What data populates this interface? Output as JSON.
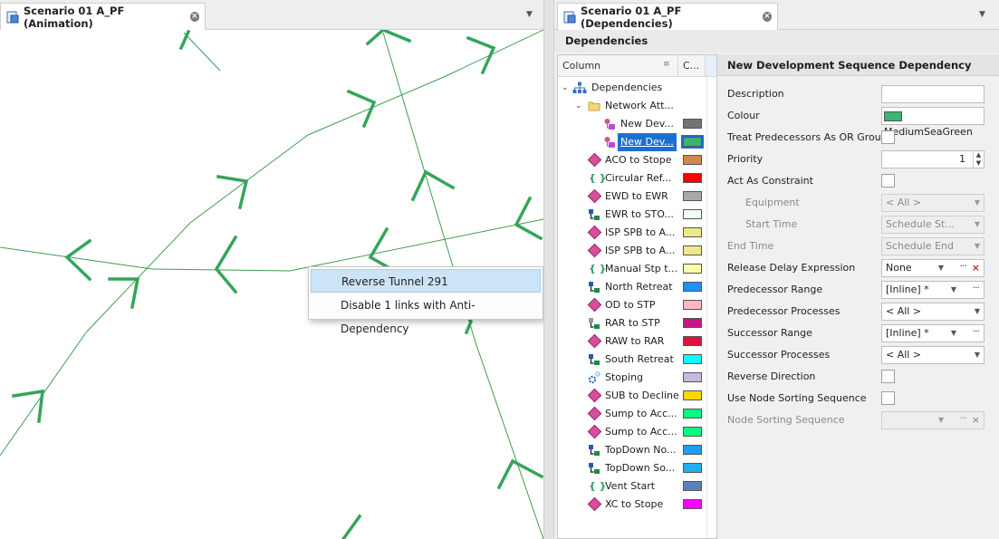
{
  "left_tab": {
    "title": "Scenario 01 A_PF (Animation)"
  },
  "right_tab": {
    "title": "Scenario 01 A_PF (Dependencies)"
  },
  "context_menu": {
    "items": [
      "Reverse Tunnel 291",
      "Disable 1 links with Anti-Dependency"
    ],
    "highlighted_index": 0
  },
  "dependencies_panel": {
    "header": "Dependencies",
    "columns": [
      "Column",
      "C..."
    ],
    "tree": [
      {
        "label": "Dependencies",
        "level": 0,
        "icon": "hierarchy-icon",
        "expanded": true
      },
      {
        "label": "Network Att...",
        "level": 1,
        "icon": "folder-icon",
        "expanded": true
      },
      {
        "label": "New Dev...",
        "level": 2,
        "icon": "dependency-node-icon",
        "color": "#737373"
      },
      {
        "label": "New Dev...",
        "level": 2,
        "icon": "dependency-node-icon",
        "color": "#3cb371",
        "selected": true
      },
      {
        "label": "ACO to Stope",
        "level": 1,
        "icon": "diamond-icon",
        "color": "#d2874b"
      },
      {
        "label": "Circular Ref...",
        "level": 1,
        "icon": "braces-icon",
        "color": "#ff0000"
      },
      {
        "label": "EWD to EWR",
        "level": 1,
        "icon": "diamond-icon",
        "color": "#a9a9a9"
      },
      {
        "label": "EWR to STO...",
        "level": 1,
        "icon": "link-node-icon",
        "color": "#f0fff0"
      },
      {
        "label": "ISP SPB to A...",
        "level": 1,
        "icon": "diamond-icon",
        "color": "#f0e68c"
      },
      {
        "label": "ISP SPB to A...",
        "level": 1,
        "icon": "diamond-icon",
        "color": "#f0e68c"
      },
      {
        "label": "Manual Stp t...",
        "level": 1,
        "icon": "braces-icon",
        "color": "#fffaaa"
      },
      {
        "label": "North Retreat",
        "level": 1,
        "icon": "link-node-icon",
        "color": "#1e90ff"
      },
      {
        "label": "OD to STP",
        "level": 1,
        "icon": "diamond-icon",
        "color": "#ffb6c1"
      },
      {
        "label": "RAR to STP",
        "level": 1,
        "icon": "link-node-gray-icon",
        "color": "#c71585"
      },
      {
        "label": "RAW to RAR",
        "level": 1,
        "icon": "diamond-icon",
        "color": "#dc143c"
      },
      {
        "label": "South Retreat",
        "level": 1,
        "icon": "link-node-icon",
        "color": "#00ffff"
      },
      {
        "label": "Stoping",
        "level": 1,
        "icon": "gear-icon",
        "color": "#c8b8e0"
      },
      {
        "label": "SUB to Decline",
        "level": 1,
        "icon": "diamond-icon",
        "color": "#ffd700"
      },
      {
        "label": "Sump to Acc...",
        "level": 1,
        "icon": "diamond-icon",
        "color": "#00ff7f"
      },
      {
        "label": "Sump to Acc...",
        "level": 1,
        "icon": "diamond-icon",
        "color": "#00ff7f"
      },
      {
        "label": "TopDown No...",
        "level": 1,
        "icon": "link-node-icon",
        "color": "#1ea0f0"
      },
      {
        "label": "TopDown So...",
        "level": 1,
        "icon": "link-node-icon",
        "color": "#1eb0f0"
      },
      {
        "label": "Vent Start",
        "level": 1,
        "icon": "braces-icon",
        "color": "#5b7fbf"
      },
      {
        "label": "XC to Stope",
        "level": 1,
        "icon": "diamond-icon",
        "color": "#ff00ff"
      }
    ]
  },
  "properties": {
    "title": "New Development Sequence Dependency",
    "rows": [
      {
        "label": "Description",
        "type": "text",
        "value": ""
      },
      {
        "label": "Colour",
        "type": "color",
        "value": "MediumSeaGreen",
        "swatch": "#3cb371"
      },
      {
        "label": "Treat Predecessors As OR Group",
        "type": "checkbox"
      },
      {
        "label": "Priority",
        "type": "spin",
        "value": "1"
      },
      {
        "label": "Act As Constraint",
        "type": "checkbox"
      },
      {
        "label": "Equipment",
        "type": "dropdown",
        "value": "< All >",
        "indent": true,
        "disabled": true
      },
      {
        "label": "Start Time",
        "type": "dropdown",
        "value": "Schedule St...",
        "indent": true,
        "disabled": true
      },
      {
        "label": "End Time",
        "type": "dropdown",
        "value": "Schedule End",
        "disabled": true
      },
      {
        "label": "Release Delay Expression",
        "type": "expr",
        "value": "None",
        "clear": true
      },
      {
        "label": "Predecessor Range",
        "type": "expr",
        "value": "[Inline] *"
      },
      {
        "label": "Predecessor Processes",
        "type": "dropdown",
        "value": "< All >"
      },
      {
        "label": "Successor Range",
        "type": "expr",
        "value": "[Inline] *"
      },
      {
        "label": "Successor Processes",
        "type": "dropdown",
        "value": "< All >"
      },
      {
        "label": "Reverse Direction",
        "type": "checkbox"
      },
      {
        "label": "Use Node Sorting Sequence",
        "type": "checkbox"
      },
      {
        "label": "Node Sorting Sequence",
        "type": "expr",
        "value": "",
        "disabled": true,
        "clear": true
      }
    ]
  },
  "colors": {
    "tunnel_line": "#3f9d52",
    "arrow": "#35a55a",
    "selection": "#1c6fd1",
    "menu_highlight": "#cce4f7"
  }
}
